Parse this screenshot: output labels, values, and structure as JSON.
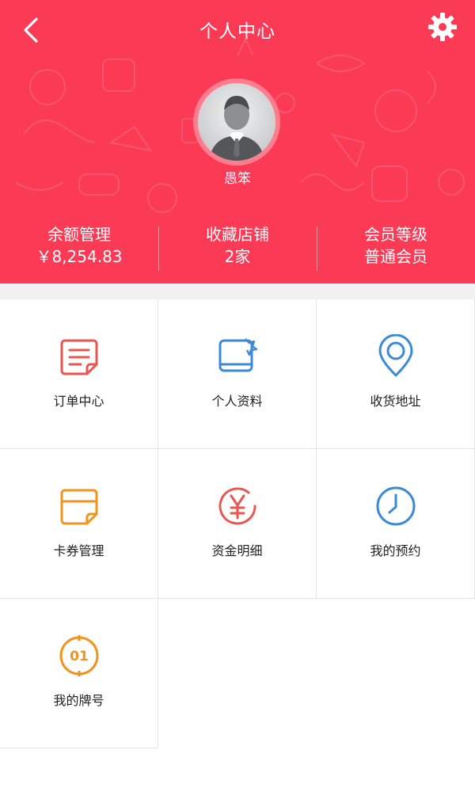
{
  "header": {
    "title": "个人中心",
    "back_icon": "chevron-left-icon",
    "settings_icon": "gear-icon",
    "background_color": "#fb3a55"
  },
  "profile": {
    "username": "愚笨",
    "avatar_icon": "user-avatar"
  },
  "stats": [
    {
      "label": "余额管理",
      "value": "￥8,254.83"
    },
    {
      "label": "收藏店铺",
      "value": "2家"
    },
    {
      "label": "会员等级",
      "value": "普通会员"
    }
  ],
  "menu": {
    "items": [
      {
        "label": "订单中心",
        "icon": "order-list-icon",
        "color": "#e9564f"
      },
      {
        "label": "个人资料",
        "icon": "profile-card-icon",
        "color": "#3a8ad6"
      },
      {
        "label": "收货地址",
        "icon": "location-pin-icon",
        "color": "#3a8ad6"
      },
      {
        "label": "卡券管理",
        "icon": "coupon-icon",
        "color": "#f0941f"
      },
      {
        "label": "资金明细",
        "icon": "yuan-icon",
        "color": "#e9564f"
      },
      {
        "label": "我的预约",
        "icon": "clock-icon",
        "color": "#3a8ad6"
      },
      {
        "label": "我的牌号",
        "icon": "number-tag-icon",
        "color": "#f0941f"
      }
    ]
  }
}
